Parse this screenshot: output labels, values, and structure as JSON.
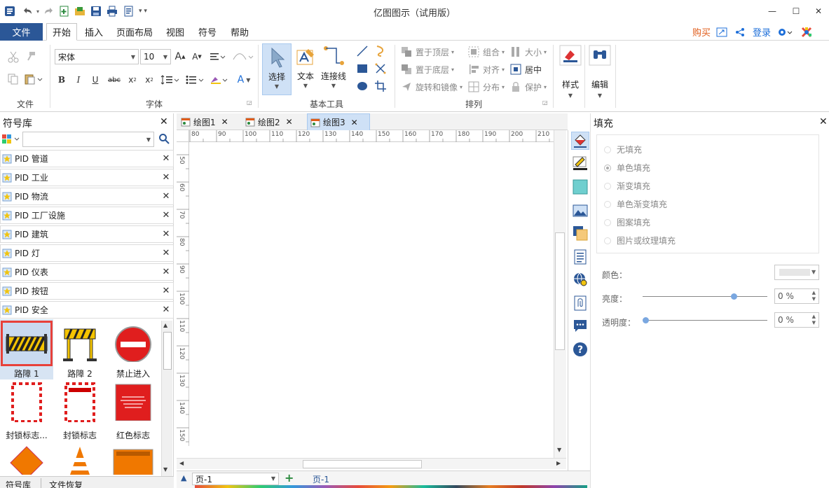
{
  "app": {
    "title": "亿图图示（试用版）"
  },
  "window": {
    "minimize": "—",
    "maximize": "☐",
    "close": "✕"
  },
  "menu": {
    "file": "文件",
    "tabs": [
      "开始",
      "插入",
      "页面布局",
      "视图",
      "符号",
      "帮助"
    ],
    "right": {
      "buy": "购买",
      "login": "登录"
    }
  },
  "ribbon": {
    "groups": {
      "file": "文件",
      "font": "字体",
      "basic_tools": "基本工具",
      "arrange": "排列"
    },
    "font": {
      "name": "宋体",
      "size": "10"
    },
    "tools": {
      "select": "选择",
      "text": "文本",
      "connector": "连接线"
    },
    "arrange": {
      "bring_front": "置于顶层",
      "send_back": "置于底层",
      "rotate_mirror": "旋转和镜像",
      "group": "组合",
      "align": "对齐",
      "distribute": "分布",
      "size": "大小",
      "center": "居中",
      "protect": "保护"
    },
    "style": "样式",
    "edit": "编辑"
  },
  "sidebar": {
    "title": "符号库",
    "search_placeholder": "",
    "libraries": [
      "PID 管道",
      "PID 工业",
      "PID 物流",
      "PID 工厂设施",
      "PID 建筑",
      "PID 灯",
      "PID 仪表",
      "PID 按钮",
      "PID 安全"
    ],
    "symbols": [
      "路障 1",
      "路障 2",
      "禁止进入",
      "封锁标志...",
      "封锁标志",
      "红色标志"
    ],
    "bottom_tabs": [
      "符号库",
      "文件恢复"
    ]
  },
  "documents": {
    "tabs": [
      "绘图1",
      "绘图2",
      "绘图3"
    ]
  },
  "ruler": {
    "h": [
      "80",
      "90",
      "100",
      "110",
      "120",
      "130",
      "140",
      "150",
      "160",
      "170",
      "180",
      "190",
      "200",
      "210"
    ],
    "v": [
      "50",
      "60",
      "70",
      "80",
      "90",
      "100",
      "110",
      "120",
      "130",
      "140",
      "150",
      "160"
    ]
  },
  "fill_panel": {
    "title": "填充",
    "options": [
      "无填充",
      "单色填充",
      "渐变填充",
      "单色渐变填充",
      "图案填充",
      "图片或纹理填充"
    ],
    "color_label": "颜色：",
    "brightness_label": "亮度：",
    "brightness_value": "0 %",
    "transparency_label": "透明度：",
    "transparency_value": "0 %",
    "brightness_level": 0.73,
    "transparency_level": 0.0
  },
  "pages": {
    "current": "页-1",
    "tab": "页-1"
  },
  "colors": {
    "file_tab": "#2b5797",
    "accent": "#1e6fd9",
    "buy": "#e05c1a"
  }
}
